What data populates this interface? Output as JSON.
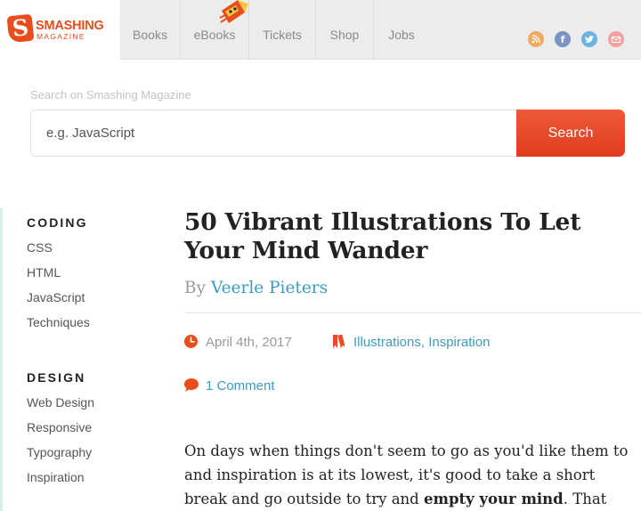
{
  "header": {
    "logo_word": "SMASHING",
    "logo_sub": "MAGAZINE",
    "nav": [
      {
        "label": "Books"
      },
      {
        "label": "eBooks"
      },
      {
        "label": "Tickets"
      },
      {
        "label": "Shop"
      },
      {
        "label": "Jobs"
      }
    ],
    "social": [
      "rss-icon",
      "facebook-icon",
      "twitter-icon",
      "newsletter-icon"
    ]
  },
  "search": {
    "label": "Search on Smashing Magazine",
    "placeholder": "e.g. JavaScript",
    "button_label": "Search"
  },
  "sidebar": {
    "sections": [
      {
        "heading": "CODING",
        "items": [
          "CSS",
          "HTML",
          "JavaScript",
          "Techniques"
        ]
      },
      {
        "heading": "DESIGN",
        "items": [
          "Web Design",
          "Responsive",
          "Typography",
          "Inspiration"
        ]
      }
    ]
  },
  "article": {
    "title": "50 Vibrant Illustrations To Let Your Mind Wander",
    "by": "By",
    "author": "Veerle Pieters",
    "date": "April 4th, 2017",
    "tags": "Illustrations, Inspiration",
    "comments": "1 Comment",
    "intro_start": "On days when things don't seem to go as you'd like them to and inspiration is at its lowest, it's good to take a short break and go outside to try and ",
    "intro_bold": "empty your mind",
    "intro_end": ". That"
  },
  "colors": {
    "accent": "#e84d1c",
    "link": "#3b9cc1"
  }
}
